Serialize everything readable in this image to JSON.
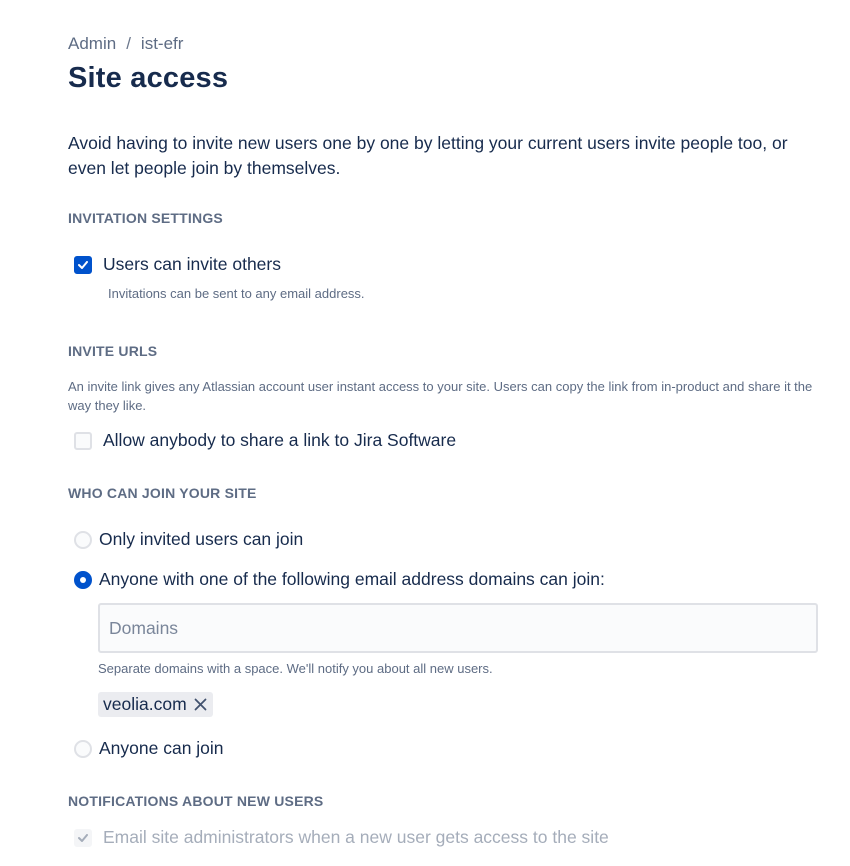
{
  "breadcrumb": {
    "root": "Admin",
    "separator": "/",
    "current": "ist-efr"
  },
  "page_title": "Site access",
  "intro": "Avoid having to invite new users one by one by letting your current users invite people too, or even let people join by themselves.",
  "invitation_settings": {
    "heading": "INVITATION SETTINGS",
    "users_can_invite": {
      "label": "Users can invite others",
      "checked": true,
      "helper": "Invitations can be sent to any email address."
    }
  },
  "invite_urls": {
    "heading": "INVITE URLS",
    "description": "An invite link gives any Atlassian account user instant access to your site. Users can copy the link from in-product and share it the way they like.",
    "allow_share_link": {
      "label": "Allow anybody to share a link to Jira Software",
      "checked": false
    }
  },
  "who_can_join": {
    "heading": "WHO CAN JOIN YOUR SITE",
    "options": [
      {
        "label": "Only invited users can join",
        "selected": false
      },
      {
        "label": "Anyone with one of the following email address domains can join:",
        "selected": true
      },
      {
        "label": "Anyone can join",
        "selected": false
      }
    ],
    "domains_input": {
      "placeholder": "Domains",
      "value": ""
    },
    "domains_helper": "Separate domains with a space. We'll notify you about all new users.",
    "domain_tags": [
      "veolia.com"
    ]
  },
  "notifications": {
    "heading": "NOTIFICATIONS ABOUT NEW USERS",
    "email_admins": {
      "label": "Email site administrators when a new user gets access to the site",
      "checked": true,
      "disabled": true
    }
  },
  "colors": {
    "accent": "#0052cc",
    "text": "#172b4d",
    "subtle": "#5e6c84",
    "border": "#dfe1e6"
  }
}
